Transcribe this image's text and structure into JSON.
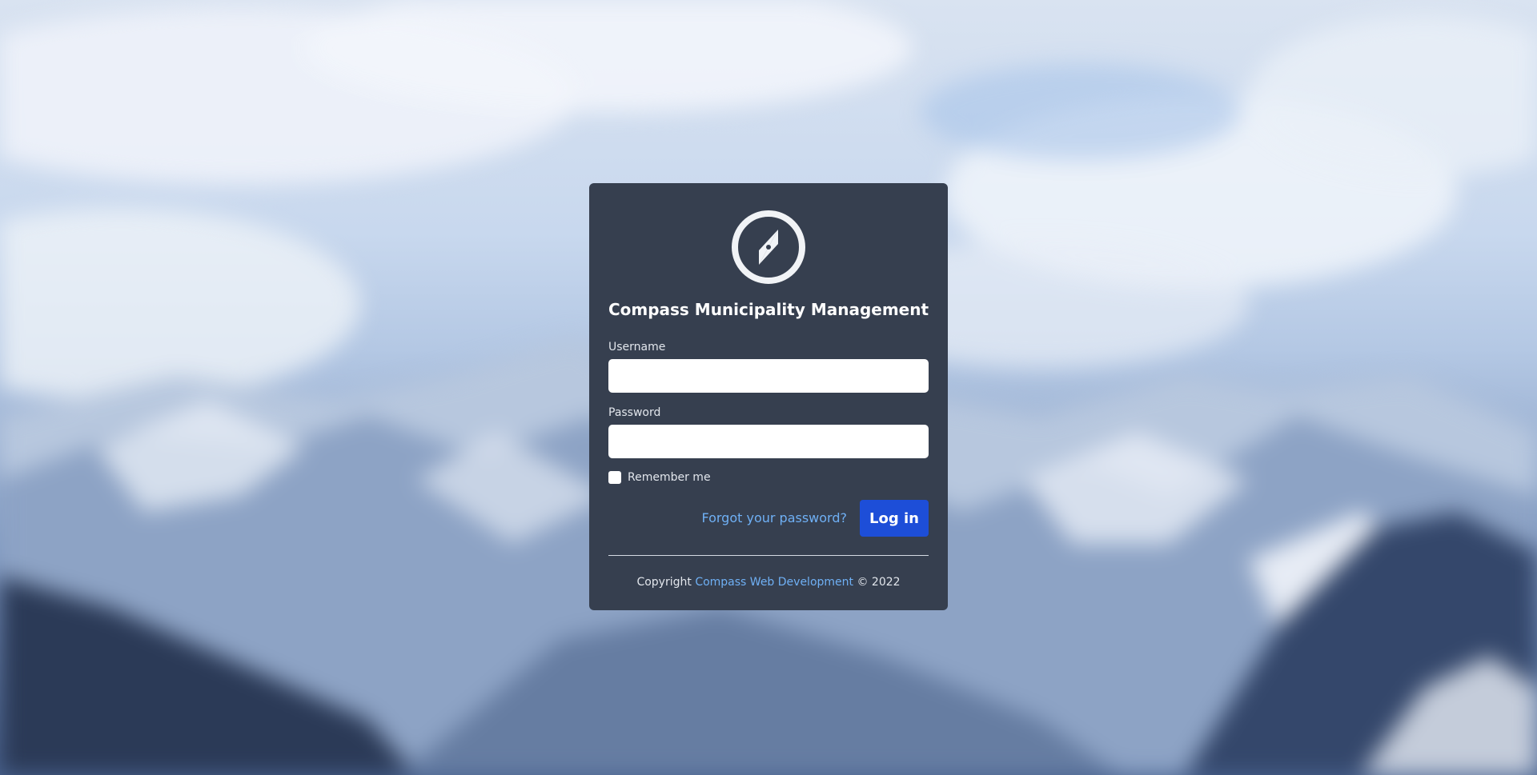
{
  "app": {
    "title": "Compass Municipality Management",
    "logo_icon": "compass-icon"
  },
  "form": {
    "username_label": "Username",
    "username_value": "",
    "password_label": "Password",
    "password_value": "",
    "remember_label": "Remember me",
    "remember_checked": false,
    "forgot_link": "Forgot your password?",
    "login_button": "Log in"
  },
  "footer": {
    "prefix": "Copyright",
    "company_link": "Compass Web Development",
    "suffix": "© 2022"
  },
  "colors": {
    "card_bg": "#363f4f",
    "accent": "#1d4ed8",
    "link": "#6fb0f5"
  }
}
